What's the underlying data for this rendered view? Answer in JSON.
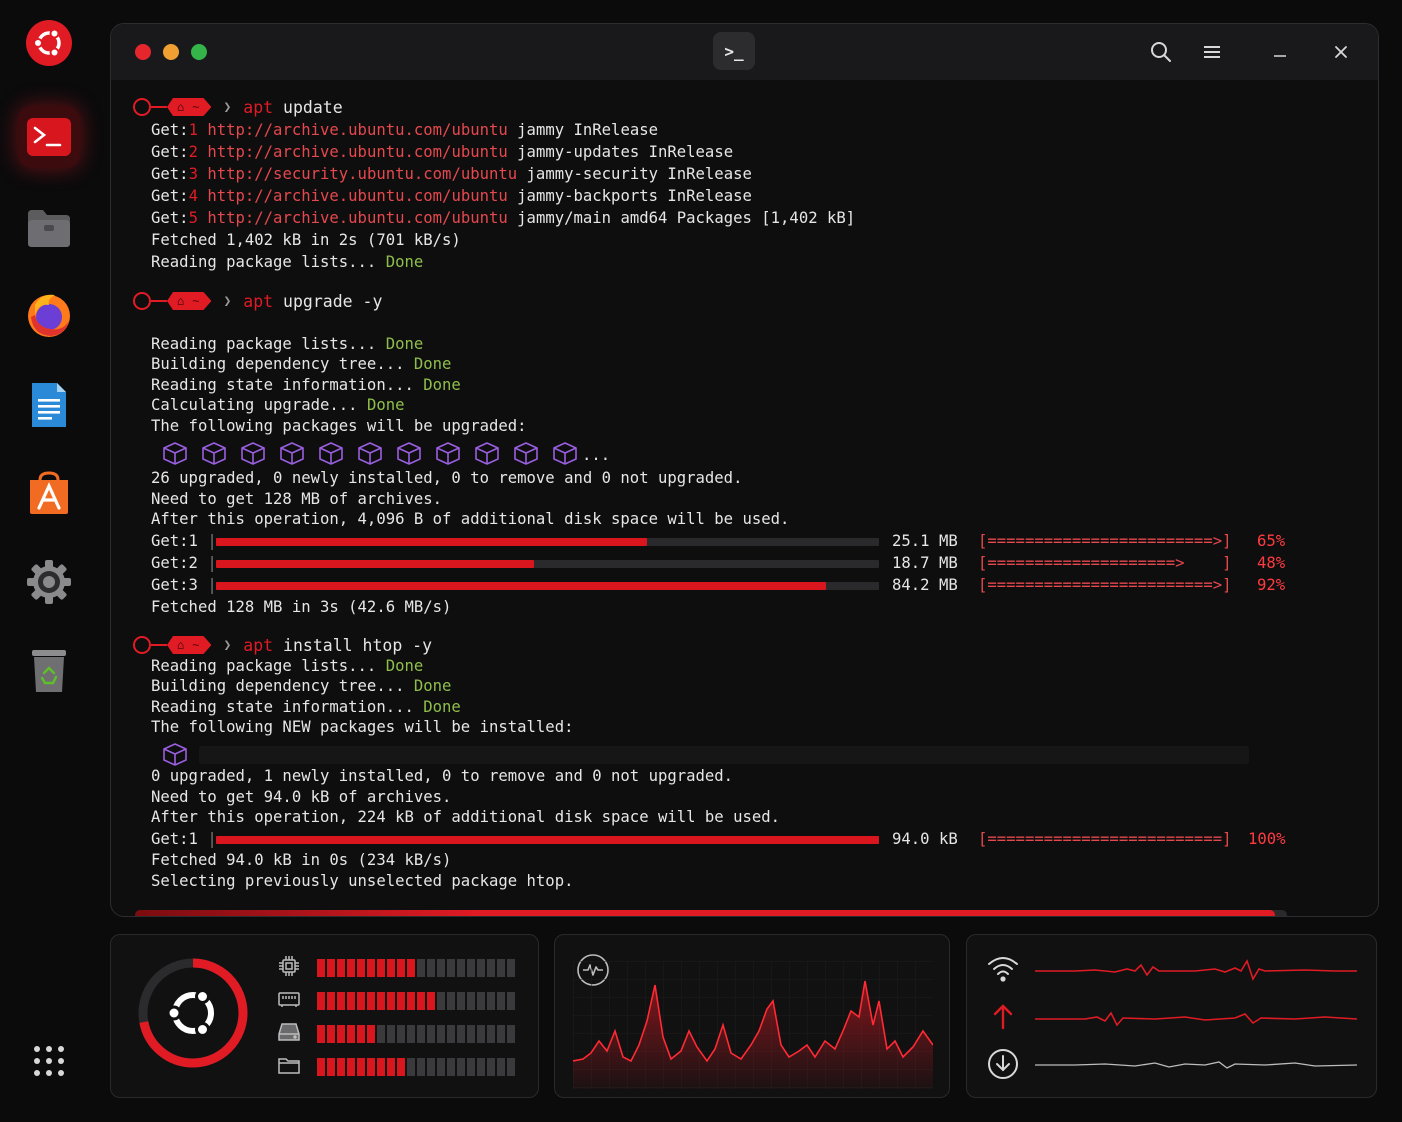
{
  "colors": {
    "accent": "#e01b24",
    "done": "#8fbf4a",
    "bg": "#0b0b0c"
  },
  "dock": {
    "items": [
      {
        "name": "ubuntu-logo-icon"
      },
      {
        "name": "terminal-icon",
        "active": true
      },
      {
        "name": "files-icon"
      },
      {
        "name": "firefox-icon"
      },
      {
        "name": "writer-icon"
      },
      {
        "name": "app-center-icon"
      },
      {
        "name": "settings-icon"
      },
      {
        "name": "trash-icon"
      },
      {
        "name": "apps-grid-icon"
      }
    ]
  },
  "window": {
    "tab_glyph": ">_",
    "controls": [
      "search-icon",
      "menu-icon",
      "minimize-icon",
      "close-icon"
    ]
  },
  "prompt": {
    "home_glyph": "⌂",
    "path": "~",
    "chevron": "❯"
  },
  "blocks": [
    {
      "command": {
        "kw": "apt",
        "rest": " update"
      },
      "gets": [
        {
          "label": "Get:",
          "n": "1",
          "url": "http://archive.ubuntu.com/ubuntu",
          "rest": " jammy InRelease"
        },
        {
          "label": "Get:",
          "n": "2",
          "url": "http://archive.ubuntu.com/ubuntu",
          "rest": " jammy-updates InRelease"
        },
        {
          "label": "Get:",
          "n": "3",
          "url": "http://security.ubuntu.com/ubuntu",
          "rest": " jammy-security InRelease"
        },
        {
          "label": "Get:",
          "n": "4",
          "url": "http://archive.ubuntu.com/ubuntu",
          "rest": " jammy-backports InRelease"
        },
        {
          "label": "Get:",
          "n": "5",
          "url": "http://archive.ubuntu.com/ubuntu",
          "rest": " jammy/main amd64 Packages [1,402 kB]"
        }
      ],
      "fetched": "Fetched 1,402 kB in 2s (701 kB/s)",
      "reading": {
        "text": "Reading package lists... ",
        "status": "Done"
      }
    },
    {
      "command": {
        "kw": "apt",
        "rest": " upgrade -y"
      },
      "steps": [
        {
          "text": "Reading package lists... ",
          "status": "Done"
        },
        {
          "text": "Building dependency tree... ",
          "status": "Done"
        },
        {
          "text": "Reading state information... ",
          "status": "Done"
        },
        {
          "text": "Calculating upgrade... ",
          "status": "Done"
        }
      ],
      "following": "The following packages will be upgraded:",
      "package_icons": 11,
      "package_ellipsis": "...",
      "summary": [
        "26 upgraded, 0 newly installed, 0 to remove and 0 not upgraded.",
        "Need to get 128 MB of archives.",
        "After this operation, 4,096 B of additional disk space will be used."
      ],
      "downloads": [
        {
          "label": "Get:1",
          "progress": 0.65,
          "size": "25.1 MB",
          "bar": "[========================>]",
          "pct": "65%"
        },
        {
          "label": "Get:2",
          "progress": 0.48,
          "size": "18.7 MB",
          "bar": "[====================>    ]",
          "pct": "48%"
        },
        {
          "label": "Get:3",
          "progress": 0.92,
          "size": "84.2 MB",
          "bar": "[========================>]",
          "pct": "92%"
        }
      ],
      "fetched": "Fetched 128 MB in 3s (42.6 MB/s)"
    },
    {
      "command": {
        "kw": "apt",
        "rest": " install htop -y"
      },
      "steps": [
        {
          "text": "Reading package lists... ",
          "status": "Done"
        },
        {
          "text": "Building dependency tree... ",
          "status": "Done"
        },
        {
          "text": "Reading state information... ",
          "status": "Done"
        }
      ],
      "following": "The following NEW packages will be installed:",
      "summary": [
        "0 upgraded, 1 newly installed, 0 to remove and 0 not upgraded.",
        "Need to get 94.0 kB of archives.",
        "After this operation, 224 kB of additional disk space will be used."
      ],
      "downloads": [
        {
          "label": "Get:1",
          "progress": 1.0,
          "size": "94.0 kB",
          "bar": "[=========================]",
          "pct": "100%"
        }
      ],
      "fetched": "Fetched 94.0 kB in 0s (234 kB/s)",
      "selecting": "Selecting previously unselected package htop."
    }
  ],
  "overall_progress": 0.99,
  "monitor": {
    "ring_progress": 0.72,
    "meters": [
      {
        "icon": "cpu-icon",
        "level": 0.52
      },
      {
        "icon": "memory-icon",
        "level": 0.58
      },
      {
        "icon": "disk-icon",
        "level": 0.32
      },
      {
        "icon": "folder-icon",
        "level": 0.45
      }
    ],
    "activity_icon": "activity-icon",
    "network_icons": [
      "wifi-icon",
      "upload-icon",
      "download-icon"
    ]
  }
}
